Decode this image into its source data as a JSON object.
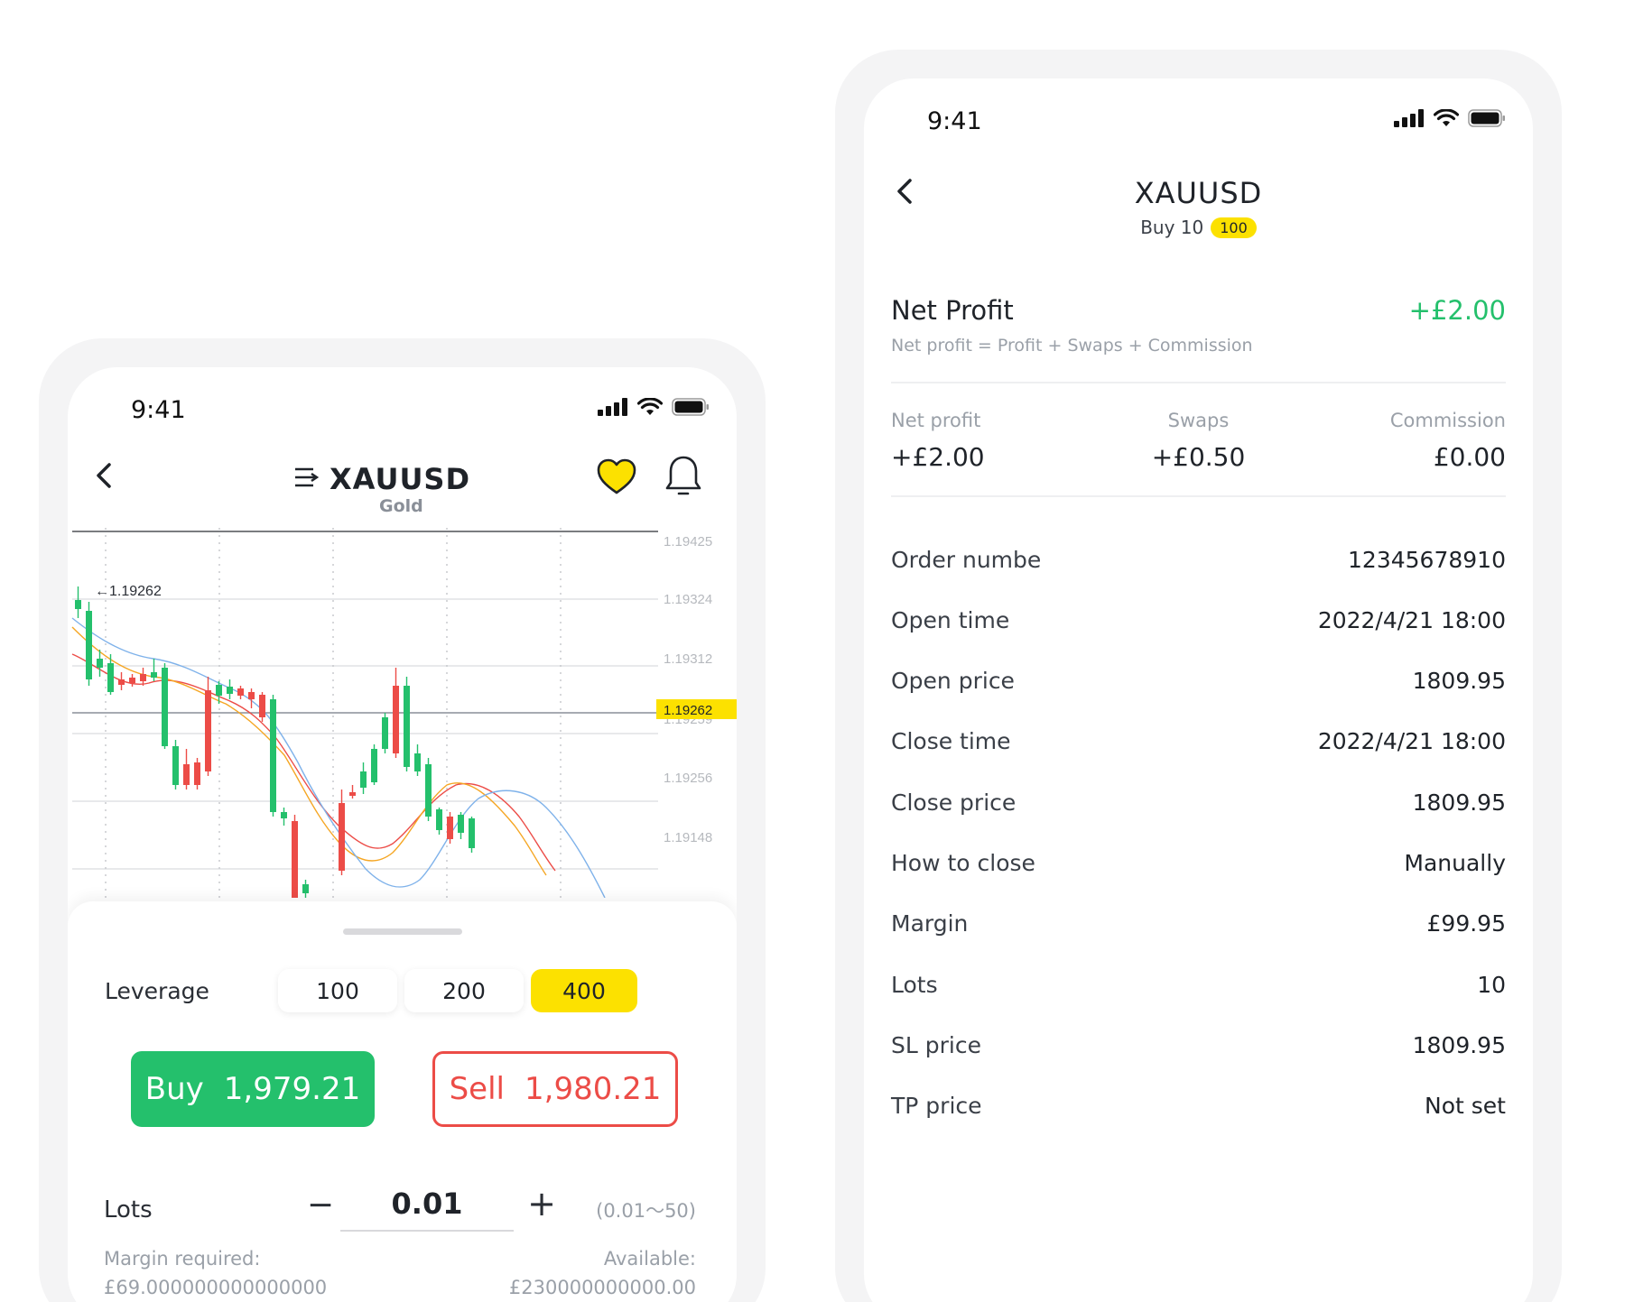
{
  "left_phone": {
    "status": {
      "time": "9:41"
    },
    "header": {
      "symbol": "XAUUSD",
      "subtitle": "Gold"
    },
    "chart": {
      "price_marker_label": "←1.19262",
      "current_price": "1.19262",
      "y_tick_labels": [
        "1.19425",
        "1.19324",
        "1.19312",
        "1.19259",
        "1.19256",
        "1.19148"
      ],
      "colors": {
        "up": "#24c06c",
        "down": "#ec4c47",
        "current_price_bg": "#fce100"
      }
    },
    "sheet": {
      "leverage_label": "Leverage",
      "leverage_options": [
        "100",
        "200",
        "400"
      ],
      "leverage_selected": "400",
      "buy": {
        "label": "Buy",
        "price": "1,979.21"
      },
      "sell": {
        "label": "Sell",
        "price": "1,980.21"
      },
      "lots_label": "Lots",
      "lots_value": "0.01",
      "lots_range": "(0.01～50)",
      "margin_label": "Margin required:",
      "margin_value": "£69.000000000000000",
      "available_label": "Available:",
      "available_value": "£230000000000.00"
    }
  },
  "right_phone": {
    "status": {
      "time": "9:41"
    },
    "header": {
      "symbol": "XAUUSD",
      "sub_text": "Buy 10",
      "badge": "100"
    },
    "net_profit": {
      "title": "Net Profit",
      "value": "+£2.00",
      "formula": "Net profit =  Profit + Swaps + Commission"
    },
    "summary": [
      {
        "label": "Net profit",
        "value": "+£2.00"
      },
      {
        "label": "Swaps",
        "value": "+£0.50"
      },
      {
        "label": "Commission",
        "value": "£0.00"
      }
    ],
    "details": [
      {
        "label": "Order numbe",
        "value": "12345678910"
      },
      {
        "label": "Open time",
        "value": "2022/4/21 18:00"
      },
      {
        "label": "Open price",
        "value": "1809.95"
      },
      {
        "label": "Close time",
        "value": "2022/4/21 18:00"
      },
      {
        "label": "Close price",
        "value": "1809.95"
      },
      {
        "label": "How to close",
        "value": "Manually"
      },
      {
        "label": "Margin",
        "value": "£99.95"
      },
      {
        "label": "Lots",
        "value": "10"
      },
      {
        "label": "SL price",
        "value": "1809.95"
      },
      {
        "label": "TP price",
        "value": "Not set"
      }
    ],
    "colors": {
      "profit": "#24c06c",
      "badge": "#fce100"
    }
  }
}
